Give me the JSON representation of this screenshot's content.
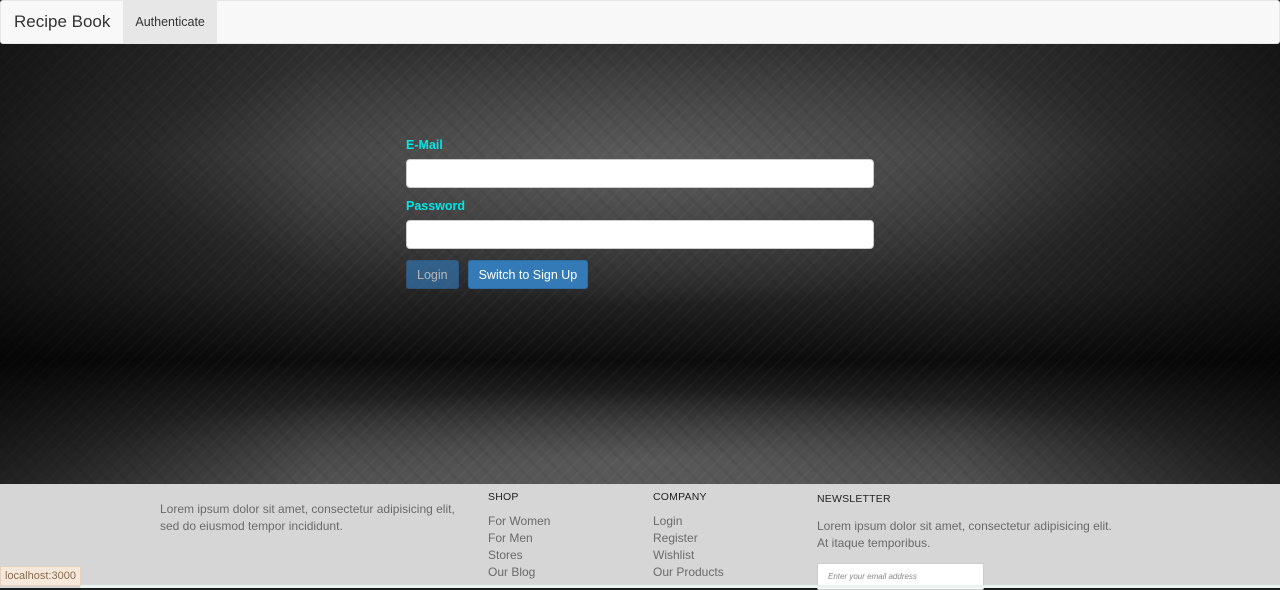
{
  "navbar": {
    "brand": "Recipe Book",
    "links": [
      "Authenticate"
    ]
  },
  "auth_form": {
    "email_label": "E-Mail",
    "email_value": "",
    "password_label": "Password",
    "password_value": "",
    "login_button": "Login",
    "switch_button": "Switch to Sign Up"
  },
  "footer": {
    "about_text": "Lorem ipsum dolor sit amet, consectetur adipisicing elit, sed do eiusmod tempor incididunt.",
    "shop": {
      "heading": "SHOP",
      "items": [
        "For Women",
        "For Men",
        "Stores",
        "Our Blog"
      ]
    },
    "company": {
      "heading": "COMPANY",
      "items": [
        "Login",
        "Register",
        "Wishlist",
        "Our Products"
      ]
    },
    "newsletter": {
      "heading": "NEWSLETTER",
      "text": "Lorem ipsum dolor sit amet, consectetur adipisicing elit. At itaque temporibus.",
      "input_placeholder": "Enter your email address"
    }
  },
  "status_bar": {
    "url": "localhost:3000"
  },
  "colors": {
    "label_accent": "#00e5e5",
    "button_primary": "#337ab7",
    "footer_bg": "#d6d6d6"
  }
}
